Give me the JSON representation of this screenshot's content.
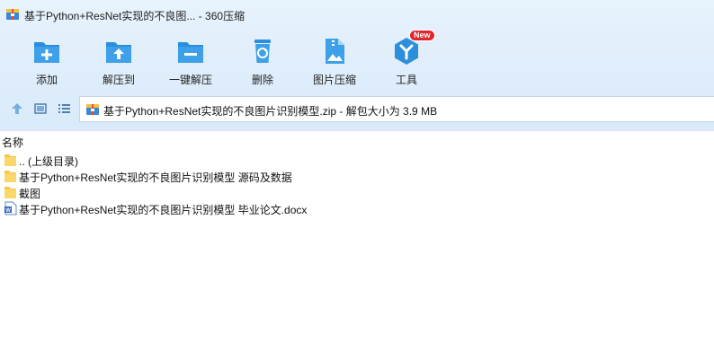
{
  "window": {
    "title": "基于Python+ResNet实现的不良图... - 360压缩",
    "title_icon": "archive-icon"
  },
  "toolbar": {
    "items": [
      {
        "label": "添加",
        "icon": "add-folder-icon"
      },
      {
        "label": "解压到",
        "icon": "extract-to-folder-icon"
      },
      {
        "label": "一键解压",
        "icon": "one-click-extract-icon"
      },
      {
        "label": "删除",
        "icon": "recycle-bin-icon"
      },
      {
        "label": "图片压缩",
        "icon": "image-compress-icon"
      },
      {
        "label": "工具",
        "icon": "tools-icon",
        "badge": "New"
      }
    ]
  },
  "nav": {
    "path": "基于Python+ResNet实现的不良图片识别模型.zip - 解包大小为 3.9 MB"
  },
  "list": {
    "column_name": "名称",
    "rows": [
      {
        "name": ".. (上级目录)",
        "icon": "folder-icon"
      },
      {
        "name": "基于Python+ResNet实现的不良图片识别模型 源码及数据",
        "icon": "folder-icon"
      },
      {
        "name": "截图",
        "icon": "folder-icon"
      },
      {
        "name": "基于Python+ResNet实现的不良图片识别模型 毕业论文.docx",
        "icon": "word-document-icon"
      }
    ]
  },
  "colors": {
    "accent": "#2b8fdc",
    "toolbar_bg": "#dfeefb",
    "folder": "#f5c642",
    "badge": "#e0242b"
  }
}
